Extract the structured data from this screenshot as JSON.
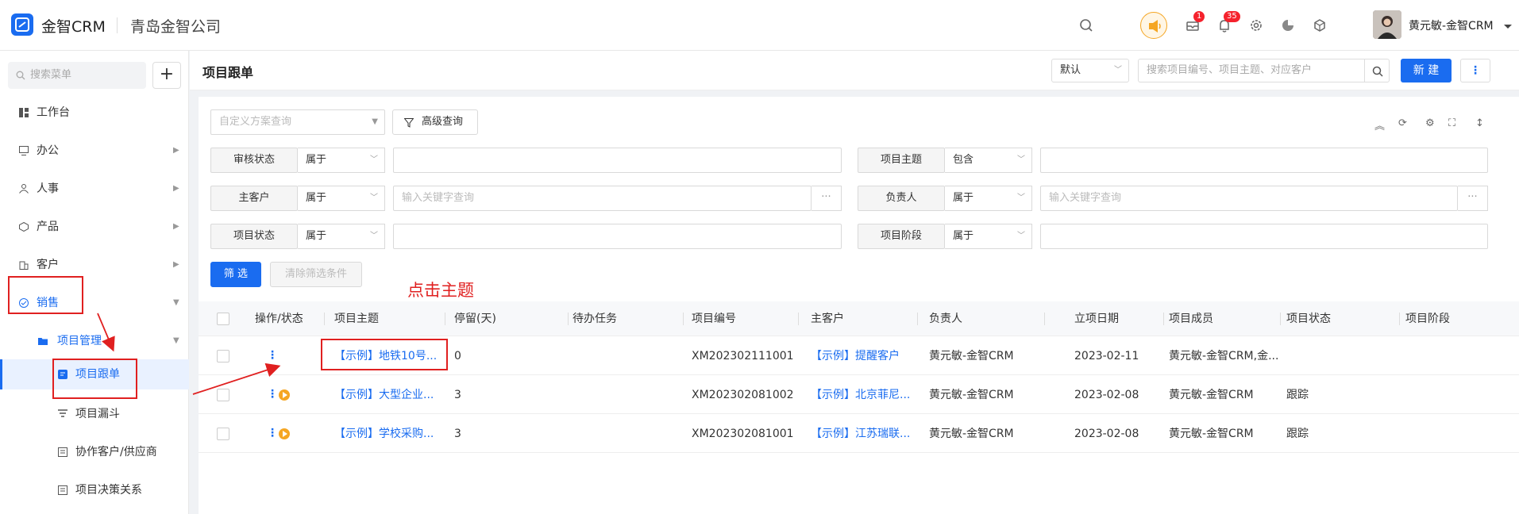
{
  "header": {
    "app_name": "金智CRM",
    "company": "青岛金智公司",
    "mail_badge": "1",
    "bell_badge": "35",
    "user_name": "黄元敏-金智CRM"
  },
  "sidebar": {
    "search_placeholder": "搜索菜单",
    "plus": "+",
    "items": [
      {
        "label": "工作台"
      },
      {
        "label": "办公"
      },
      {
        "label": "人事"
      },
      {
        "label": "产品"
      },
      {
        "label": "客户"
      },
      {
        "label": "销售"
      },
      {
        "label": "项目管理"
      },
      {
        "label": "项目跟单"
      },
      {
        "label": "项目漏斗"
      },
      {
        "label": "协作客户/供应商"
      },
      {
        "label": "项目决策关系"
      }
    ]
  },
  "page": {
    "title": "项目跟单",
    "view_select": "默认",
    "search_placeholder": "搜索项目编号、项目主题、对应客户",
    "new_button": "新 建",
    "more_button": "⋮"
  },
  "filters": {
    "scheme_placeholder": "自定义方案查询",
    "advanced_query": "高级查询",
    "rows": [
      {
        "label": "审核状态",
        "op": "属于",
        "placeholder": ""
      },
      {
        "label": "项目主题",
        "op": "包含",
        "placeholder": ""
      },
      {
        "label": "主客户",
        "op": "属于",
        "placeholder": "输入关键字查询"
      },
      {
        "label": "负责人",
        "op": "属于",
        "placeholder": "输入关键字查询"
      },
      {
        "label": "项目状态",
        "op": "属于",
        "placeholder": ""
      },
      {
        "label": "项目阶段",
        "op": "属于",
        "placeholder": ""
      }
    ],
    "dots": "···",
    "filter_button": "筛 选",
    "clear_button": "清除筛选条件"
  },
  "annotation": "点击主题",
  "table": {
    "columns": [
      "操作/状态",
      "项目主题",
      "停留(天)",
      "待办任务",
      "项目编号",
      "主客户",
      "负责人",
      "立项日期",
      "项目成员",
      "项目状态",
      "项目阶段"
    ],
    "rows": [
      {
        "subject": "【示例】地铁10号...",
        "stay": "0",
        "todo": "",
        "code": "XM202302111001",
        "customer": "【示例】提醒客户",
        "owner": "黄元敏-金智CRM",
        "date": "2023-02-11",
        "members": "黄元敏-金智CRM,金...",
        "status": "",
        "stage": "",
        "has_status_icon": false
      },
      {
        "subject": "【示例】大型企业...",
        "stay": "3",
        "todo": "",
        "code": "XM202302081002",
        "customer": "【示例】北京菲尼...",
        "owner": "黄元敏-金智CRM",
        "date": "2023-02-08",
        "members": "黄元敏-金智CRM",
        "status": "跟踪",
        "stage": "",
        "has_status_icon": true
      },
      {
        "subject": "【示例】学校采购...",
        "stay": "3",
        "todo": "",
        "code": "XM202302081001",
        "customer": "【示例】江苏瑞联...",
        "owner": "黄元敏-金智CRM",
        "date": "2023-02-08",
        "members": "黄元敏-金智CRM",
        "status": "跟踪",
        "stage": "",
        "has_status_icon": true
      }
    ]
  },
  "colors": {
    "accent": "#1a6cf0",
    "annotation": "#e02020",
    "status_icon": "#f5a623"
  }
}
